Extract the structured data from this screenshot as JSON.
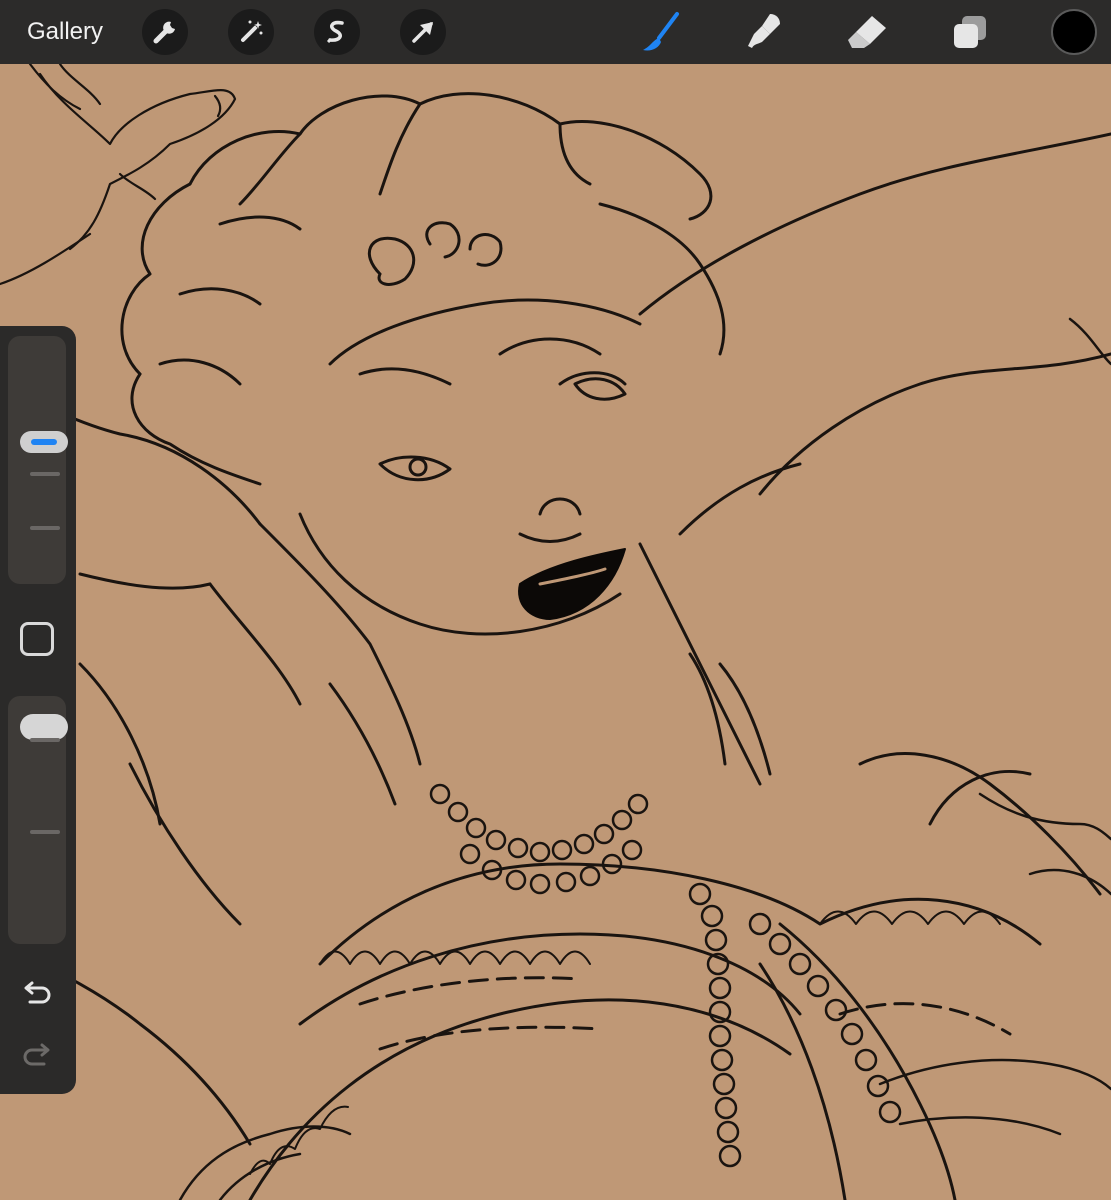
{
  "topbar": {
    "gallery_label": "Gallery",
    "left_tools": [
      "wrench-icon",
      "magic-wand-icon",
      "selection-icon",
      "transform-arrow-icon"
    ],
    "right_tools": [
      "brush-icon",
      "smudge-icon",
      "eraser-icon",
      "layers-icon"
    ],
    "active_tool": "brush-icon",
    "active_color": "#1f84f3",
    "current_color": "#000000"
  },
  "sidebar": {
    "brush_size_level": 0.58,
    "opacity_level": 0.92,
    "controls": [
      "brush-size-slider",
      "modify-button",
      "opacity-slider",
      "undo-icon",
      "redo-icon"
    ]
  },
  "canvas": {
    "background": "#bf9876",
    "line_color": "#1a1410"
  }
}
